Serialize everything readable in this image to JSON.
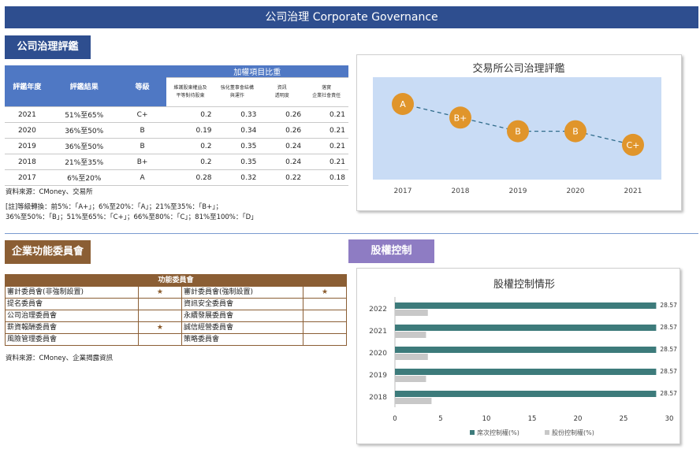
{
  "page": {
    "title": "公司治理 Corporate Governance"
  },
  "section_rating": {
    "label": "公司治理評鑑"
  },
  "section_committee": {
    "label": "企業功能委員會"
  },
  "section_equity": {
    "label": "股權控制"
  },
  "rating_table": {
    "group_header": "加權項目比重",
    "col_year": "評鑑年度",
    "col_result": "評鑑結果",
    "col_grade": "等級",
    "sub_headers": [
      [
        "維護股東權益及",
        "平等對待股東"
      ],
      [
        "強化董事會結構",
        "與運作"
      ],
      [
        "資訊",
        "透明度"
      ],
      [
        "落實",
        "企業社會責任"
      ]
    ],
    "rows": [
      {
        "year": "2021",
        "result": "51%至65%",
        "grade": "C+",
        "w1": "0.2",
        "w2": "0.33",
        "w3": "0.26",
        "w4": "0.21"
      },
      {
        "year": "2020",
        "result": "36%至50%",
        "grade": "B",
        "w1": "0.19",
        "w2": "0.34",
        "w3": "0.26",
        "w4": "0.21"
      },
      {
        "year": "2019",
        "result": "36%至50%",
        "grade": "B",
        "w1": "0.2",
        "w2": "0.35",
        "w3": "0.24",
        "w4": "0.21"
      },
      {
        "year": "2018",
        "result": "21%至35%",
        "grade": "B+",
        "w1": "0.2",
        "w2": "0.35",
        "w3": "0.24",
        "w4": "0.21"
      },
      {
        "year": "2017",
        "result": "6%至20%",
        "grade": "A",
        "w1": "0.28",
        "w2": "0.32",
        "w3": "0.22",
        "w4": "0.18"
      }
    ]
  },
  "rating_notes": {
    "source": "資料來源：CMoney、交易所",
    "conv_line1": "[註]等級轉換：前5%：「A+」；6%至20%：「A」；21%至35%：「B+」；",
    "conv_line2": "36%至50%：「B」；51%至65%：「C+」；66%至80%：「C」；81%至100%：「D」"
  },
  "committee_table": {
    "header": "功能委員會",
    "rows": [
      {
        "left": "審計委員會(非強制設置)",
        "left_star": "★",
        "right": "審計委員會(強制設置)",
        "right_star": "★"
      },
      {
        "left": "提名委員會",
        "left_star": "",
        "right": "資訊安全委員會",
        "right_star": ""
      },
      {
        "left": "公司治理委員會",
        "left_star": "",
        "right": "永續發展委員會",
        "right_star": ""
      },
      {
        "left": "薪資報酬委員會",
        "left_star": "★",
        "right": "誠信經營委員會",
        "right_star": ""
      },
      {
        "left": "風險管理委員會",
        "left_star": "",
        "right": "策略委員會",
        "right_star": ""
      }
    ],
    "source": "資料來源：CMoney、企業揭露資訊"
  },
  "colors": {
    "title_bar": "#2e4e8f",
    "blue_tab": "#2e4e8f",
    "brown_tab": "#8b5e34",
    "purple_tab": "#8e7cc3",
    "rating_circle": "#e0952b",
    "rating_plot_bg": "#c9dcf5",
    "seat_bar": "#3d7b7b",
    "share_bar": "#c8c8c8"
  },
  "chart_data": [
    {
      "type": "line",
      "title": "交易所公司治理評鑑",
      "x": [
        "2017",
        "2018",
        "2019",
        "2020",
        "2021"
      ],
      "grades": [
        "A",
        "B+",
        "B",
        "B",
        "C+"
      ],
      "grade_levels": [
        "A",
        "B+",
        "B",
        "C+"
      ],
      "legend": "none"
    },
    {
      "type": "bar",
      "orientation": "horizontal",
      "title": "股權控制情形",
      "categories": [
        "2022",
        "2021",
        "2020",
        "2019",
        "2018"
      ],
      "series": [
        {
          "name": "席次控制權(%)",
          "values": [
            28.57,
            28.57,
            28.57,
            28.57,
            28.57
          ],
          "color": "#3d7b7b"
        },
        {
          "name": "股份控制權(%)",
          "values": [
            3.6,
            3.4,
            3.6,
            3.4,
            4.0
          ],
          "color": "#c8c8c8"
        }
      ],
      "xlim": [
        0,
        30
      ],
      "xticks": [
        "0",
        "5",
        "10",
        "15",
        "20",
        "25",
        "30"
      ],
      "data_labels": [
        "28.57",
        "28.57",
        "28.57",
        "28.57",
        "28.57"
      ],
      "legend": "bottom"
    }
  ]
}
